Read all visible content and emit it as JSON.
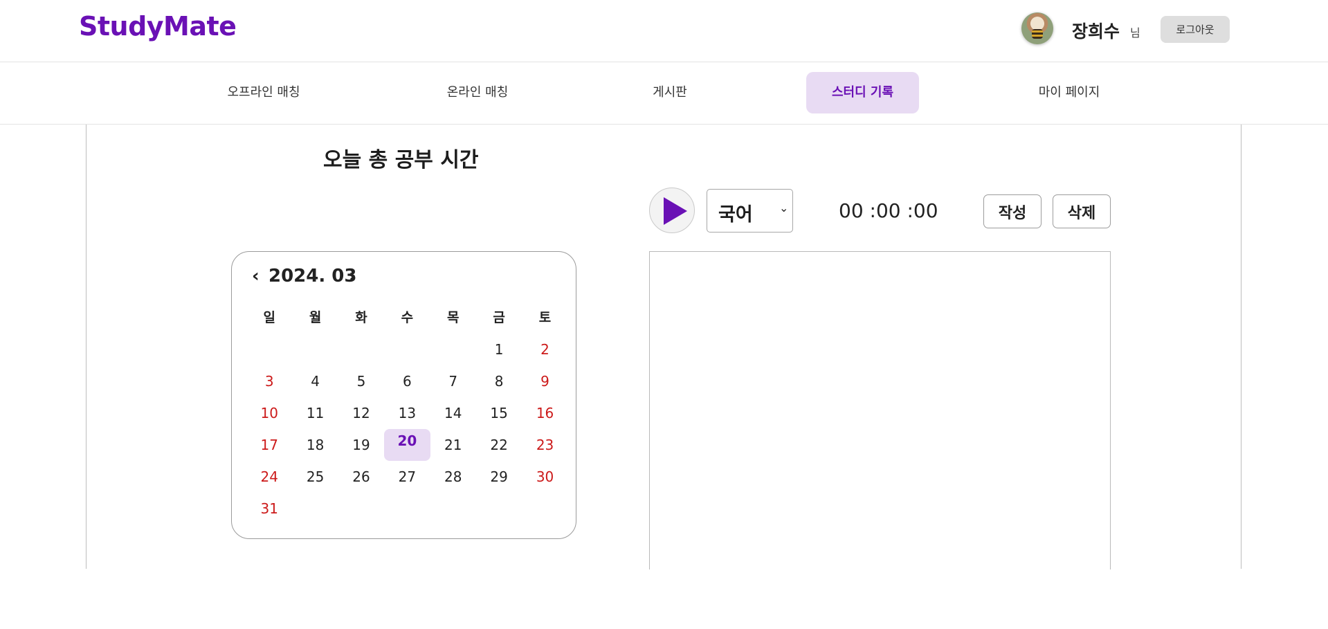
{
  "header": {
    "logo": "StudyMate",
    "user_name": "장희수",
    "user_suffix": "님",
    "logout_label": "로그아웃",
    "avatar_icon": "user-avatar-photo"
  },
  "nav": {
    "items": [
      {
        "label": "오프라인 매칭",
        "active": false
      },
      {
        "label": "온라인 매칭",
        "active": false
      },
      {
        "label": "게시판",
        "active": false
      },
      {
        "label": "스터디 기록",
        "active": true
      },
      {
        "label": "마이 페이지",
        "active": false
      }
    ]
  },
  "main": {
    "today_title": "오늘 총 공부 시간"
  },
  "calendar": {
    "prev_label": "‹",
    "month_label": "2024. 03",
    "next_label": "›",
    "weekdays": [
      "일",
      "월",
      "화",
      "수",
      "목",
      "금",
      "토"
    ],
    "weeks": [
      [
        "",
        "",
        "",
        "",
        "",
        "1",
        "2"
      ],
      [
        "3",
        "4",
        "5",
        "6",
        "7",
        "8",
        "9"
      ],
      [
        "10",
        "11",
        "12",
        "13",
        "14",
        "15",
        "16"
      ],
      [
        "17",
        "18",
        "19",
        "20",
        "21",
        "22",
        "23"
      ],
      [
        "24",
        "25",
        "26",
        "27",
        "28",
        "29",
        "30"
      ],
      [
        "31",
        "",
        "",
        "",
        "",
        "",
        ""
      ]
    ],
    "selected_day": "20"
  },
  "timer": {
    "play_icon": "play-icon",
    "subject_selected": "국어",
    "time_display": "00 :00 :00",
    "write_label": "작성",
    "delete_label": "삭제"
  },
  "colors": {
    "brand": "#6a11b5",
    "active_bg": "#e8dbf3",
    "weekend": "#cc1a1a"
  }
}
